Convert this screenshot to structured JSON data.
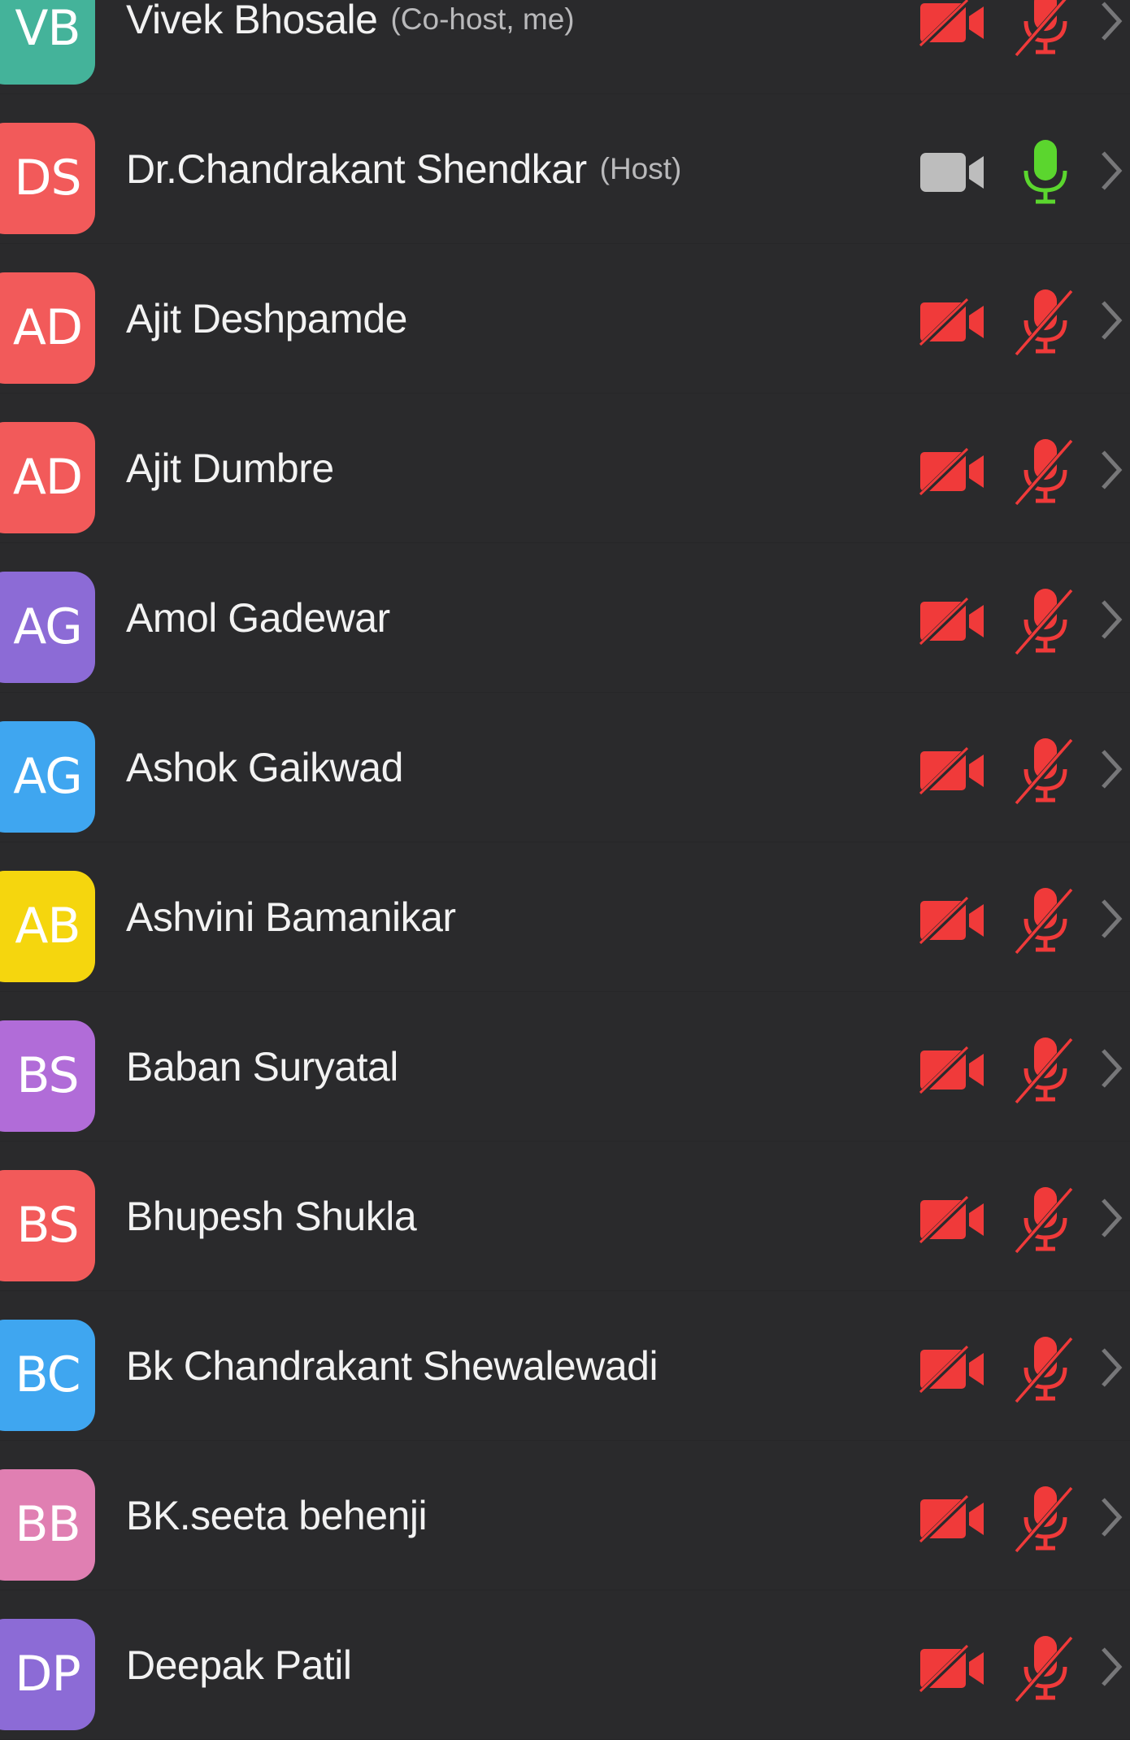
{
  "colors": {
    "background": "#2a2a2c",
    "muted_red": "#f03a3a",
    "unmuted_green": "#5bd62e",
    "camera_on_gray": "#bdbdbd",
    "chevron_gray": "#777779"
  },
  "participants": [
    {
      "initials": "VB",
      "name": "Vivek Bhosale",
      "role": "(Co-host, me)",
      "avatar_color": "#44b39a",
      "camera": "off",
      "mic": "muted"
    },
    {
      "initials": "DS",
      "name": "Dr.Chandrakant Shendkar",
      "role": "(Host)",
      "avatar_color": "#f25a5a",
      "camera": "on",
      "mic": "unmuted"
    },
    {
      "initials": "AD",
      "name": "Ajit Deshpamde",
      "role": "",
      "avatar_color": "#f25a5a",
      "camera": "off",
      "mic": "muted"
    },
    {
      "initials": "AD",
      "name": "Ajit Dumbre",
      "role": "",
      "avatar_color": "#f25a5a",
      "camera": "off",
      "mic": "muted"
    },
    {
      "initials": "AG",
      "name": "Amol Gadewar",
      "role": "",
      "avatar_color": "#8c6bd6",
      "camera": "off",
      "mic": "muted"
    },
    {
      "initials": "AG",
      "name": "Ashok Gaikwad",
      "role": "",
      "avatar_color": "#3fa6f0",
      "camera": "off",
      "mic": "muted"
    },
    {
      "initials": "AB",
      "name": "Ashvini Bamanikar",
      "role": "",
      "avatar_color": "#f5d60e",
      "camera": "off",
      "mic": "muted"
    },
    {
      "initials": "BS",
      "name": "Baban Suryatal",
      "role": "",
      "avatar_color": "#b16cd8",
      "camera": "off",
      "mic": "muted"
    },
    {
      "initials": "BS",
      "name": "Bhupesh Shukla",
      "role": "",
      "avatar_color": "#f25a5a",
      "camera": "off",
      "mic": "muted"
    },
    {
      "initials": "BC",
      "name": "Bk Chandrakant Shewalewadi",
      "role": "",
      "avatar_color": "#3fa6f0",
      "camera": "off",
      "mic": "muted"
    },
    {
      "initials": "BB",
      "name": "BK.seeta behenji",
      "role": "",
      "avatar_color": "#e07fb2",
      "camera": "off",
      "mic": "muted"
    },
    {
      "initials": "DP",
      "name": "Deepak Patil",
      "role": "",
      "avatar_color": "#8c6bd6",
      "camera": "off",
      "mic": "muted"
    }
  ]
}
